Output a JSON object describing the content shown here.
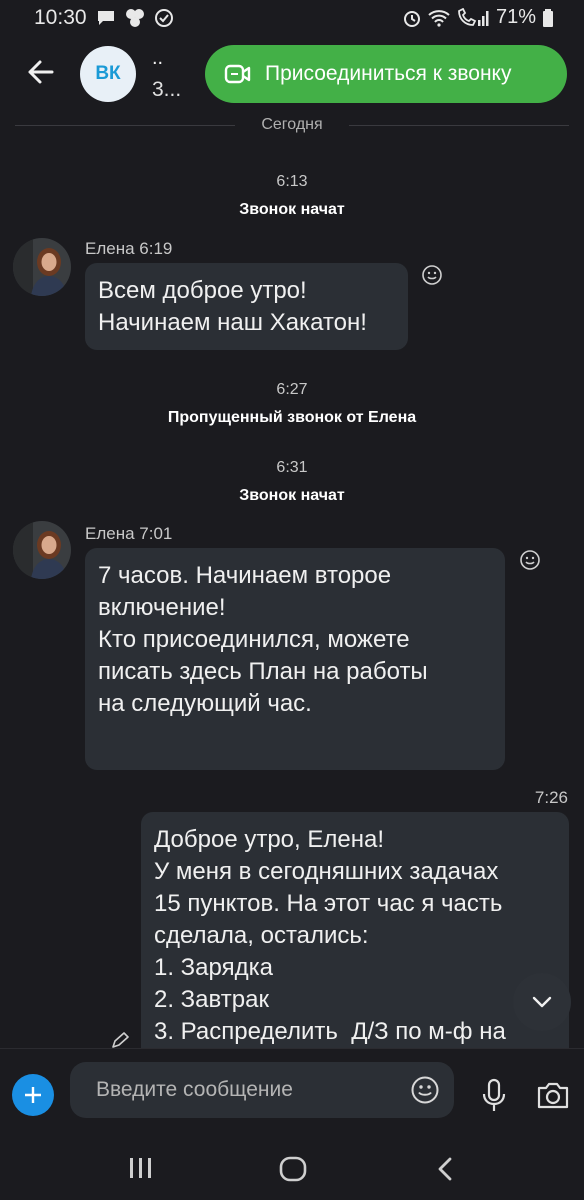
{
  "status_bar": {
    "time": "10:30",
    "battery": "71%",
    "left_icons": [
      "chat-bubble-icon",
      "vk-icon",
      "check-circle-icon"
    ],
    "right_icons": [
      "alarm-icon",
      "wifi-icon",
      "call-signal-icon",
      "battery-icon"
    ]
  },
  "header": {
    "avatar_text": "ВК",
    "title_dots": "..",
    "title_sub": "3...",
    "join_label": "Присоединиться к звонку"
  },
  "day_divider": "Сегодня",
  "system_events": [
    {
      "time": "6:13",
      "text": "Звонок начат"
    },
    {
      "time": "6:27",
      "text": "Пропущенный звонок от Елена"
    },
    {
      "time": "6:31",
      "text": "Звонок начат"
    }
  ],
  "messages": [
    {
      "sender": "Елена 6:19",
      "lines": [
        "Всем доброе утро!",
        "Начинаем наш Хакатон!"
      ]
    },
    {
      "sender": "Елена 7:01",
      "lines": [
        "7 часов. Начинаем второе",
        "включение!",
        "Кто присоединился, можете",
        "писать здесь План на работы",
        "на следующий час."
      ]
    }
  ],
  "own_message": {
    "time": "7:26",
    "lines": [
      "Доброе утро, Елена!",
      "У меня в сегодняшних задачах",
      "15 пунктов. На этот час я часть",
      "сделала, остались:",
      "1. Зарядка",
      "2. Завтрак",
      "3. Распределить  Д/З по м-ф на"
    ]
  },
  "composer": {
    "placeholder": "Введите сообщение"
  },
  "colors": {
    "background": "#1b1b1f",
    "bubble": "#2b2f35",
    "join_button": "#43b047",
    "accent": "#1a8fe3"
  }
}
